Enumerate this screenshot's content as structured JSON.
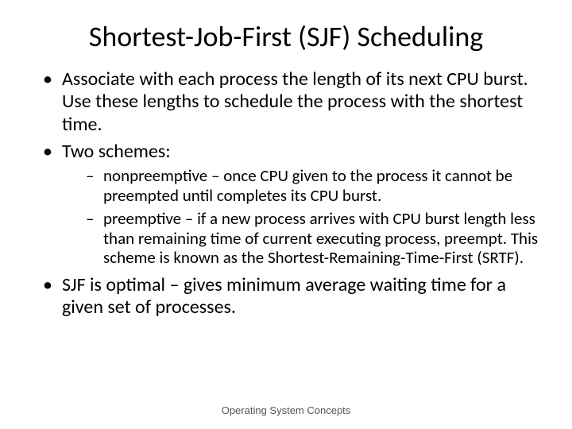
{
  "title": "Shortest-Job-First (SJF) Scheduling",
  "bullets": {
    "b1": "Associate with each process the length of its next CPU burst.  Use these lengths to schedule the process with the shortest time.",
    "b2": "Two schemes:",
    "s1": "nonpreemptive – once CPU given to the process it cannot be preempted until completes its CPU burst.",
    "s2": "preemptive – if a new process arrives with CPU burst length less than remaining time of current executing process, preempt.  This scheme is known as the Shortest-Remaining-Time-First (SRTF).",
    "b3": "SJF is optimal – gives minimum average waiting time for a given set of processes."
  },
  "footer": "Operating System Concepts"
}
